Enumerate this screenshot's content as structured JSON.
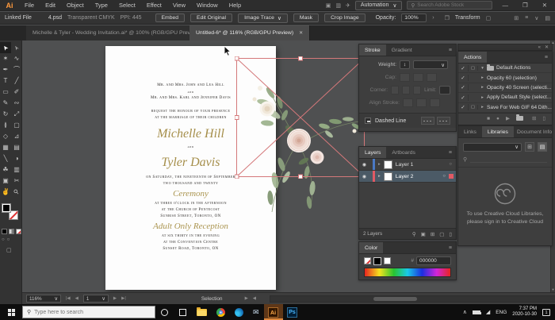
{
  "app": {
    "name": "Adobe Illustrator",
    "logo": "Ai"
  },
  "colors": {
    "selection_pink": "#d4787a",
    "script_gold": "#a58e4a",
    "layer1_color": "#4a79c4",
    "layer2_color": "#e05a64",
    "ai_brand": "#ff9a3d",
    "ps_brand": "#31a8ff"
  },
  "icons": {
    "chevron_down": "∨",
    "chevron_right": "›",
    "chevron_up": "∧",
    "close": "✕",
    "minimize": "—",
    "restore": "❐",
    "magnifier": "⚲",
    "menu": "≡",
    "check": "✓",
    "tri_right": "▸",
    "tri_down": "▾",
    "target_circle": "○",
    "eye": "◉",
    "collapse_left": "«",
    "play": "▶",
    "stop": "■",
    "record": "●",
    "trash": "▯",
    "new_item": "⊞",
    "list_view": "▤",
    "grid_view": "⊞",
    "first": "|◀",
    "prev": "◀",
    "next": "▶",
    "last": "▶|",
    "scroll_up": "▴",
    "scroll_down": "▾",
    "share": "✈",
    "arrange_docs": "▥",
    "app_home": "▣",
    "touch_workspace": "▢",
    "panel_strip": "▤",
    "stepper": "↕",
    "wifi": "◢",
    "locate": "⚲",
    "make_mask": "▣",
    "new_sublayer": "⊞",
    "new_layer": "▢"
  },
  "menubar": {
    "items": [
      "File",
      "Edit",
      "Object",
      "Type",
      "Select",
      "Effect",
      "View",
      "Window",
      "Help"
    ],
    "automation": "Automation",
    "search_placeholder": "Search Adobe Stock"
  },
  "control_bar": {
    "linked_file": "Linked File",
    "file_name": "4.psd",
    "color_mode": "Transparent CMYK",
    "ppi": "PPI: 445",
    "buttons": [
      "Embed",
      "Edit Original",
      "Image Trace",
      "Mask",
      "Crop Image"
    ],
    "opacity_label": "Opacity:",
    "opacity_value": "100%",
    "transform": "Transform"
  },
  "tabs": [
    {
      "title": "Michelle & Tyler - Wedding Invitation.ai* @ 100% (RGB/GPU Preview)",
      "active": false
    },
    {
      "title": "Untitled-6* @ 116% (RGB/GPU Preview)",
      "active": true
    }
  ],
  "tools": [
    {
      "name": "selection-tool",
      "g": "➤"
    },
    {
      "name": "direct-selection-tool",
      "g": "➣"
    },
    {
      "name": "magic-wand-tool",
      "g": "✶"
    },
    {
      "name": "lasso-tool",
      "g": "∿"
    },
    {
      "name": "pen-tool",
      "g": "✒"
    },
    {
      "name": "curvature-tool",
      "g": "⌒"
    },
    {
      "name": "type-tool",
      "g": "T"
    },
    {
      "name": "line-segment-tool",
      "g": "╱"
    },
    {
      "name": "rectangle-tool",
      "g": "▭"
    },
    {
      "name": "paintbrush-tool",
      "g": "✐"
    },
    {
      "name": "pencil-tool",
      "g": "✎"
    },
    {
      "name": "shaper-tool",
      "g": "∾"
    },
    {
      "name": "rotate-tool",
      "g": "↻"
    },
    {
      "name": "scale-tool",
      "g": "⤢"
    },
    {
      "name": "width-tool",
      "g": "≬"
    },
    {
      "name": "free-transform-tool",
      "g": "▢"
    },
    {
      "name": "shape-builder-tool",
      "g": "◇"
    },
    {
      "name": "perspective-grid-tool",
      "g": "⊿"
    },
    {
      "name": "mesh-tool",
      "g": "▦"
    },
    {
      "name": "gradient-tool",
      "g": "▤"
    },
    {
      "name": "eyedropper-tool",
      "g": "╲"
    },
    {
      "name": "blend-tool",
      "g": "◑"
    },
    {
      "name": "symbol-sprayer-tool",
      "g": "☘"
    },
    {
      "name": "graph-tool",
      "g": "▥"
    },
    {
      "name": "artboard-tool",
      "g": "▣"
    },
    {
      "name": "slice-tool",
      "g": "✂"
    },
    {
      "name": "hand-tool",
      "g": "✌"
    },
    {
      "name": "zoom-tool",
      "g": "⚲"
    }
  ],
  "invitation": {
    "lines": [
      {
        "style": "caps",
        "text": "Mr. and Mrs. John and Lea Hill"
      },
      {
        "style": "caps-small",
        "text": "and"
      },
      {
        "style": "caps",
        "text": "Mr. and Mrs. Karl and Jennifer Davis"
      },
      {
        "style": "caps",
        "text": "request the honour of your presence"
      },
      {
        "style": "caps",
        "text": "at the marriage of their children"
      },
      {
        "style": "script-xl",
        "text": "Michelle Hill"
      },
      {
        "style": "caps-small",
        "text": "and"
      },
      {
        "style": "script-xl",
        "text": "Tyler Davis"
      },
      {
        "style": "caps",
        "text": "on Saturday, the nineteenth of September"
      },
      {
        "style": "caps",
        "text": "two thousand and twenty"
      },
      {
        "style": "script-md",
        "text": "Ceremony"
      },
      {
        "style": "caps",
        "text": "at three o'clock in the afternoon"
      },
      {
        "style": "caps",
        "text": "at the Church of Pentecost"
      },
      {
        "style": "caps",
        "text": "Sunrise Street, Toronto, ON"
      },
      {
        "style": "script-md",
        "text": "Adult Only Reception"
      },
      {
        "style": "caps",
        "text": "at six thirty in the evening"
      },
      {
        "style": "caps",
        "text": "at the Convention Centre"
      },
      {
        "style": "caps",
        "text": "Sunset Road, Toronto, ON"
      }
    ]
  },
  "panels": {
    "stroke": {
      "tabs": [
        "Stroke",
        "Gradient"
      ],
      "weight_label": "Weight:",
      "cap_label": "Cap:",
      "corner_label": "Corner:",
      "limit_label": "Limit:",
      "align_label": "Align Stroke:",
      "dashed_line_label": "Dashed Line"
    },
    "actions": {
      "title": "Actions",
      "items": [
        {
          "label": "Default Actions"
        },
        {
          "label": "Opacity 60 (selection)"
        },
        {
          "label": "Opacity 40 Screen (selecti..."
        },
        {
          "label": "Apply Default Style (select..."
        },
        {
          "label": "Save For Web GIF 64 Dith..."
        }
      ]
    },
    "layers": {
      "tabs": [
        "Layers",
        "Artboards"
      ],
      "items": [
        {
          "name": "Layer 1"
        },
        {
          "name": "Layer 2"
        }
      ],
      "count": "2 Layers"
    },
    "libraries": {
      "tabs": [
        "Links",
        "Libraries",
        "Document Info"
      ],
      "message_line1": "To use Creative Cloud Libraries,",
      "message_line2": "please sign in to Creative Cloud"
    },
    "color": {
      "title": "Color",
      "hex_label": "#",
      "hex_value": "000000"
    }
  },
  "status_bar": {
    "zoom": "116%",
    "artboard": "1",
    "status": "Selection"
  },
  "taskbar": {
    "search_placeholder": "Type here to search",
    "language": "ENG",
    "time": "7:37 PM",
    "date": "2020-10-30",
    "notification_count": "1",
    "ai_label": "Ai",
    "ps_label": "Ps"
  }
}
